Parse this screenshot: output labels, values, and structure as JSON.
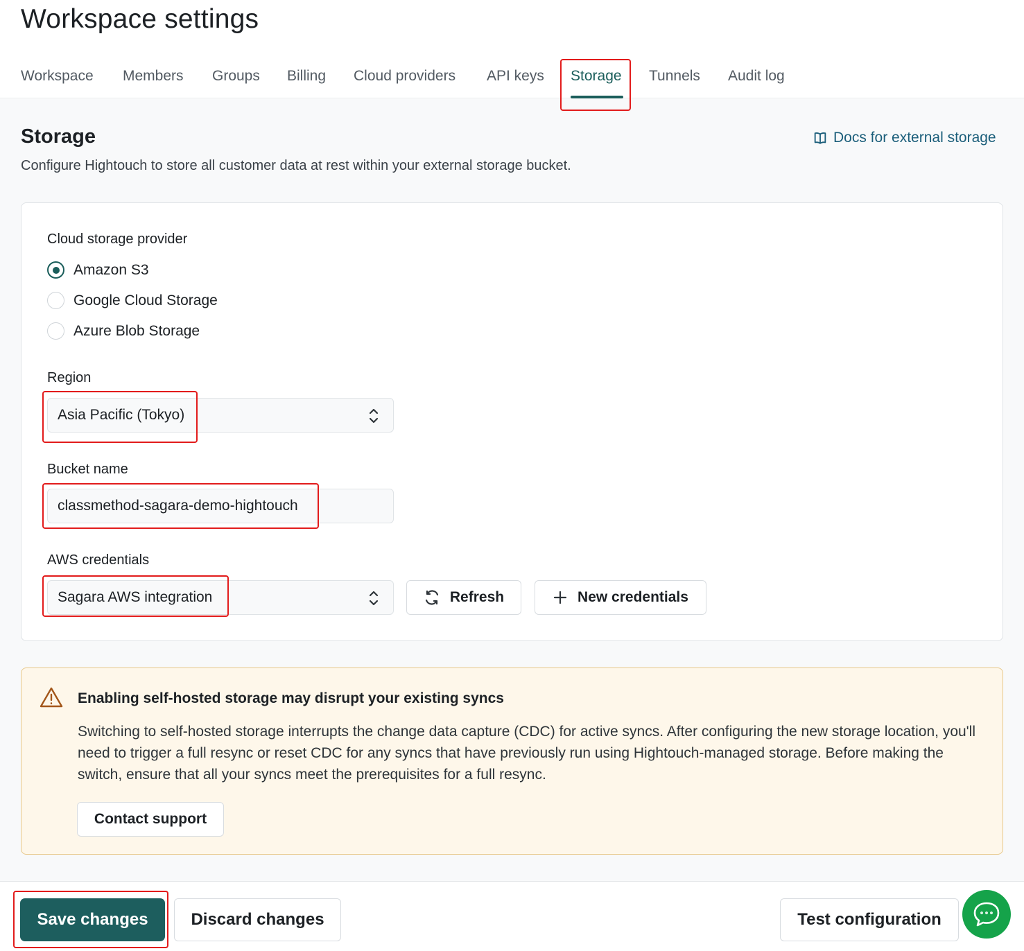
{
  "header": {
    "title": "Workspace settings",
    "tabs": [
      {
        "label": "Workspace",
        "active": false
      },
      {
        "label": "Members",
        "active": false
      },
      {
        "label": "Groups",
        "active": false
      },
      {
        "label": "Billing",
        "active": false
      },
      {
        "label": "Cloud providers",
        "active": false
      },
      {
        "label": "API keys",
        "active": false
      },
      {
        "label": "Storage",
        "active": true
      },
      {
        "label": "Tunnels",
        "active": false
      },
      {
        "label": "Audit log",
        "active": false
      }
    ]
  },
  "storage": {
    "title": "Storage",
    "description": "Configure Hightouch to store all customer data at rest within your external storage bucket.",
    "docs_link": {
      "label": "Docs for external storage",
      "icon": "book-icon"
    }
  },
  "form": {
    "provider_label": "Cloud storage provider",
    "providers": [
      {
        "label": "Amazon S3",
        "checked": true
      },
      {
        "label": "Google Cloud Storage",
        "checked": false
      },
      {
        "label": "Azure Blob Storage",
        "checked": false
      }
    ],
    "region_label": "Region",
    "region_value": "Asia Pacific (Tokyo)",
    "bucket_label": "Bucket name",
    "bucket_value": "classmethod-sagara-demo-hightouch",
    "credentials_label": "AWS credentials",
    "credentials_value": "Sagara AWS integration",
    "refresh_label": "Refresh",
    "new_credentials_label": "New credentials"
  },
  "warning": {
    "title": "Enabling self-hosted storage may disrupt your existing syncs",
    "body": "Switching to self-hosted storage interrupts the change data capture (CDC) for active syncs. After configuring the new storage location, you'll need to trigger a full resync or reset CDC for any syncs that have previously run using Hightouch-managed storage. Before making the switch, ensure that all your syncs meet the prerequisites for a full resync.",
    "contact_label": "Contact support"
  },
  "footer": {
    "save_label": "Save changes",
    "discard_label": "Discard changes",
    "test_label": "Test configuration"
  },
  "colors": {
    "accent": "#1b5e5b",
    "primary_button": "#1d5e5e",
    "warning_bg": "#fef7ea",
    "warning_border": "#e8c88a",
    "chat_button": "#15a34a",
    "highlight": "#e21b1b"
  }
}
